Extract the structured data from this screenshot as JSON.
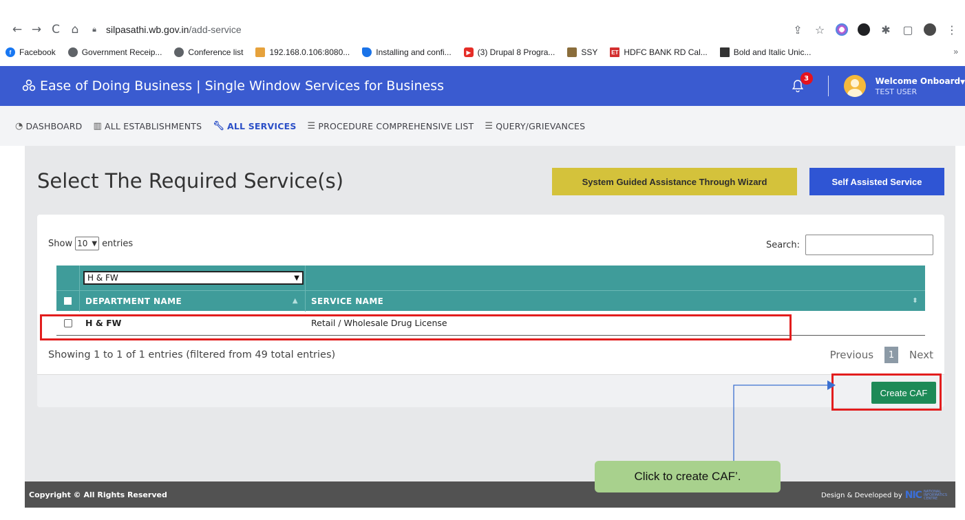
{
  "browser": {
    "url_host": "silpasathi.wb.gov.in",
    "url_path": "/add-service",
    "bookmarks": [
      {
        "label": "Facebook",
        "color": "#1877f2"
      },
      {
        "label": "Government Receip...",
        "color": "#5f6368"
      },
      {
        "label": "Conference list",
        "color": "#5f6368"
      },
      {
        "label": "192.168.0.106:8080...",
        "color": "#e6a23c"
      },
      {
        "label": "Installing and confi...",
        "color": "#1a73e8"
      },
      {
        "label": "(3) Drupal 8 Progra...",
        "color": "#e52d27"
      },
      {
        "label": "SSY",
        "color": "#8a6d3b"
      },
      {
        "label": "HDFC BANK RD Cal...",
        "color": "#d32f2f"
      },
      {
        "label": "Bold and Italic Unic...",
        "color": "#333333"
      }
    ],
    "bookmarks_more": "»"
  },
  "header": {
    "title": "Ease of Doing Business | Single Window Services for Business",
    "notification_count": "3",
    "welcome": "Welcome Onboard",
    "user": "TEST USER"
  },
  "nav": {
    "items": [
      {
        "label": "DASHBOARD",
        "icon": "gauge-icon"
      },
      {
        "label": "ALL ESTABLISHMENTS",
        "icon": "building-icon"
      },
      {
        "label": "ALL SERVICES",
        "icon": "wrench-icon",
        "active": true
      },
      {
        "label": "PROCEDURE COMPREHENSIVE LIST",
        "icon": "list-icon"
      },
      {
        "label": "QUERY/GRIEVANCES",
        "icon": "list-icon"
      }
    ]
  },
  "main": {
    "title": "Select The Required Service(s)",
    "wizard_button": "System Guided Assistance Through Wizard",
    "self_button": "Self Assisted Service",
    "show_label": "Show",
    "entries_value": "10",
    "entries_label": "entries",
    "search_label": "Search:",
    "department_filter": "H & FW",
    "columns": [
      "DEPARTMENT NAME",
      "SERVICE NAME"
    ],
    "rows": [
      {
        "department": "H & FW",
        "service": "Retail / Wholesale Drug License"
      }
    ],
    "info": "Showing 1 to 1 of 1 entries (filtered from 49 total entries)",
    "pager": {
      "previous": "Previous",
      "page": "1",
      "next": "Next"
    },
    "create_button": "Create CAF"
  },
  "footer": {
    "copyright": "Copyright © All Rights Reserved",
    "credit": "Design & Developed by",
    "nic": "NIC",
    "nic_sub": [
      "NATIONAL",
      "INFORMATICS",
      "CENTRE"
    ]
  },
  "annotation": {
    "callout": "Click to create CAF’.",
    "highlight_color": "#e21d1d",
    "connector_color": "#3a6fd0"
  },
  "colors": {
    "header_bg": "#3a5bd0",
    "table_header": "#3f9c9a",
    "wizard_bg": "#d4c23b",
    "self_bg": "#2f55d4",
    "create_bg": "#1d8a57"
  }
}
